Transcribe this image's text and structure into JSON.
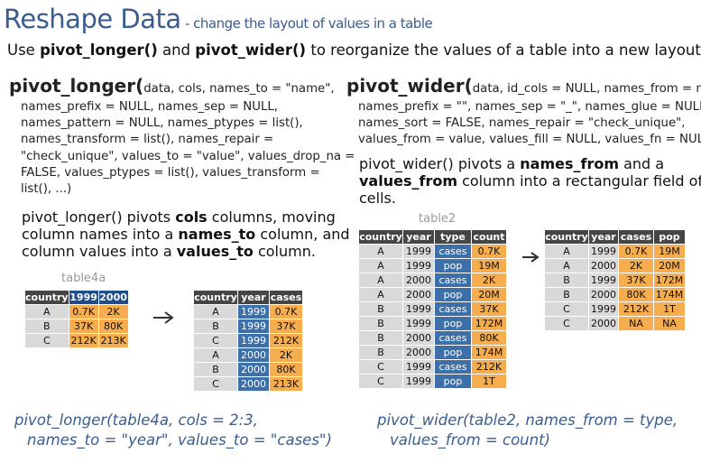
{
  "header": {
    "title": "Reshape Data",
    "subtitle": " - change the layout of values in a table",
    "intro": {
      "pre": "Use ",
      "f1": "pivot_longer()",
      "mid": " and ",
      "f2": "pivot_wider()",
      "post": " to reorganize the values of a table into a new layout."
    }
  },
  "longer": {
    "fn_name": "pivot_longer(",
    "sig_lines": [
      "data, cols, names_to = \"name\",",
      "names_prefix = NULL, names_sep = NULL,",
      "names_pattern = NULL, names_ptypes = list(),",
      "names_transform = list(), names_repair =",
      "\"check_unique\", values_to = \"value\", values_drop_na =",
      "FALSE, values_ptypes = list(), values_transform =",
      "list(), ...)"
    ],
    "desc": {
      "l1a": "pivot_longer() pivots ",
      "l1b": "cols",
      "l1c": " columns, moving",
      "l2a": "column names into a ",
      "l2b": "names_to",
      "l2c": " column, and",
      "l3a": "column values into a ",
      "l3b": "values_to",
      "l3c": " column."
    },
    "caption": "table4a",
    "input_table": {
      "headers": [
        "country",
        "1999",
        "2000"
      ],
      "rows": [
        [
          "A",
          "0.7K",
          "2K"
        ],
        [
          "B",
          "37K",
          "80K"
        ],
        [
          "C",
          "212K",
          "213K"
        ]
      ]
    },
    "output_table": {
      "headers": [
        "country",
        "year",
        "cases"
      ],
      "rows": [
        [
          "A",
          "1999",
          "0.7K"
        ],
        [
          "B",
          "1999",
          "37K"
        ],
        [
          "C",
          "1999",
          "212K"
        ],
        [
          "A",
          "2000",
          "2K"
        ],
        [
          "B",
          "2000",
          "80K"
        ],
        [
          "C",
          "2000",
          "213K"
        ]
      ]
    },
    "code_lines": [
      "pivot_longer(table4a, cols = 2:3,",
      "names_to = \"year\", values_to = \"cases\")"
    ]
  },
  "wider": {
    "fn_name": "pivot_wider(",
    "sig_lines": [
      "data, id_cols = NULL, names_from = name,",
      "names_prefix = \"\", names_sep = \"_\", names_glue = NULL,",
      "names_sort = FALSE, names_repair = \"check_unique\",",
      "values_from = value, values_fill = NULL, values_fn = NULL, ..."
    ],
    "desc": {
      "l1a": "pivot_wider() pivots a ",
      "l1b": "names_from",
      "l1c": " and a",
      "l2a": "",
      "l2b": "values_from",
      "l2c": " column into a rectangular field of",
      "l3a": "cells.",
      "l3b": "",
      "l3c": ""
    },
    "caption": "table2",
    "input_table": {
      "headers": [
        "country",
        "year",
        "type",
        "count"
      ],
      "rows": [
        [
          "A",
          "1999",
          "cases",
          "0.7K"
        ],
        [
          "A",
          "1999",
          "pop",
          "19M"
        ],
        [
          "A",
          "2000",
          "cases",
          "2K"
        ],
        [
          "A",
          "2000",
          "pop",
          "20M"
        ],
        [
          "B",
          "1999",
          "cases",
          "37K"
        ],
        [
          "B",
          "1999",
          "pop",
          "172M"
        ],
        [
          "B",
          "2000",
          "cases",
          "80K"
        ],
        [
          "B",
          "2000",
          "pop",
          "174M"
        ],
        [
          "C",
          "1999",
          "cases",
          "212K"
        ],
        [
          "C",
          "1999",
          "pop",
          "1T"
        ]
      ]
    },
    "output_table": {
      "headers": [
        "country",
        "year",
        "cases",
        "pop"
      ],
      "rows": [
        [
          "A",
          "1999",
          "0.7K",
          "19M"
        ],
        [
          "A",
          "2000",
          "2K",
          "20M"
        ],
        [
          "B",
          "1999",
          "37K",
          "172M"
        ],
        [
          "B",
          "2000",
          "80K",
          "174M"
        ],
        [
          "C",
          "1999",
          "212K",
          "1T"
        ],
        [
          "C",
          "2000",
          "NA",
          "NA"
        ]
      ]
    },
    "code_lines": [
      "pivot_wider(table2, names_from = type,",
      "values_from = count)"
    ]
  },
  "colors": {
    "title_blue": "#3a5d8f",
    "header_dark": "#454545",
    "cell_grey": "#d9d9d9",
    "blue_cell": "#3d6fa8",
    "orange_cell": "#f5ad4e",
    "caption_grey": "#9a9a9a"
  }
}
